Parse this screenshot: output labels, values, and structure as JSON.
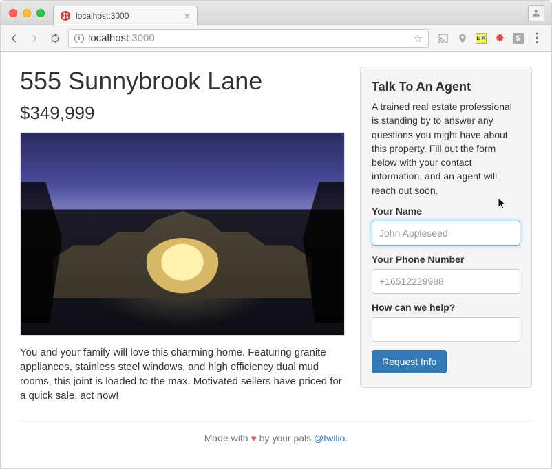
{
  "browser": {
    "tab_title": "localhost:3000",
    "url_host": "localhost",
    "url_port": ":3000",
    "info_char": "i",
    "ext_k": "E K",
    "ext_s": "S",
    "menu_dots": "⋮"
  },
  "listing": {
    "title": "555 Sunnybrook Lane",
    "price": "$349,999",
    "description": "You and your family will love this charming home. Featuring granite appliances, stainless steel windows, and high efficiency dual mud rooms, this joint is loaded to the max. Motivated sellers have priced for a quick sale, act now!"
  },
  "sidebar": {
    "heading": "Talk To An Agent",
    "blurb": "A trained real estate professional is standing by to answer any questions you might have about this property. Fill out the form below with your contact information, and an agent will reach out soon.",
    "name_label": "Your Name",
    "name_placeholder": "John Appleseed",
    "phone_label": "Your Phone Number",
    "phone_placeholder": "+16512229988",
    "help_label": "How can we help?",
    "submit_label": "Request Info"
  },
  "footer": {
    "prefix": "Made with ",
    "heart": "♥",
    "mid": " by your pals ",
    "link_text": "@twilio",
    "suffix": "."
  }
}
